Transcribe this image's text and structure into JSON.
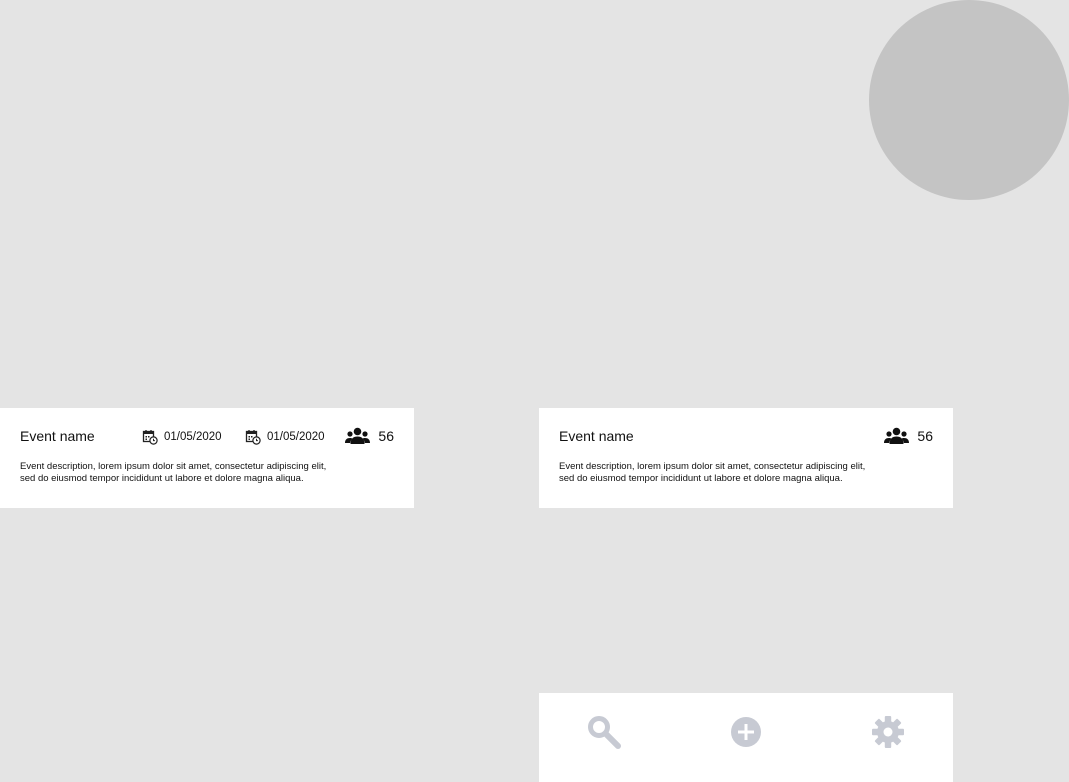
{
  "event_cards": [
    {
      "name": "Event name",
      "start_date": "01/05/2020",
      "end_date": "01/05/2020",
      "attendee_count": "56",
      "description_line1": "Event description, lorem ipsum dolor sit amet, consectetur adipiscing elit,",
      "description_line2": "sed do eiusmod tempor incididunt ut labore et dolore magna aliqua."
    },
    {
      "name": "Event name",
      "attendee_count": "56",
      "description_line1": "Event description, lorem ipsum dolor sit amet, consectetur adipiscing elit,",
      "description_line2": "sed do eiusmod tempor incididunt ut labore et dolore magna aliqua."
    }
  ],
  "icons": {
    "calendar": "calendar-clock-icon",
    "attendees": "group-icon",
    "nav": [
      "search-icon",
      "add-circle-icon",
      "gear-icon"
    ]
  },
  "colors": {
    "background": "#e4e4e4",
    "card": "#ffffff",
    "placeholder_circle": "#c4c4c4",
    "nav_icon": "#c7cad3",
    "text": "#111111"
  }
}
